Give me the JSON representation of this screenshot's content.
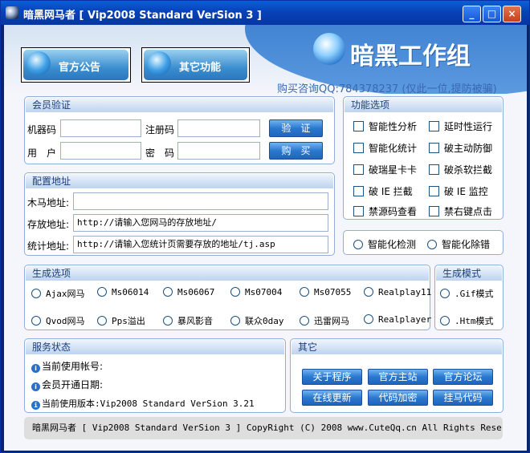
{
  "window": {
    "title": "暗黑网马者 [ Vip2008 Standard VerSion 3 ]",
    "min": "_",
    "max": "□",
    "close": "×"
  },
  "banner": {
    "btn_notice": "官方公告",
    "btn_other": "其它功能",
    "logo": "暗黑工作组",
    "contact": "购买咨询QQ:784378237 (仅此一位,提防被骗)"
  },
  "member": {
    "header": "会员验证",
    "machine_label": "机器码",
    "regcode_label": "注册码",
    "user_label": "用　户",
    "pwd_label": "密　码",
    "verify_btn": "验　证",
    "buy_btn": "购　买"
  },
  "config": {
    "header": "配置地址",
    "trojan_label": "木马地址:",
    "trojan_value": "",
    "store_label": "存放地址:",
    "store_value": "http://请输入您网马的存放地址/",
    "stats_label": "统计地址:",
    "stats_value": "http://请输入您统计页需要存放的地址/tj.asp"
  },
  "features": {
    "header": "功能选项",
    "items": [
      "智能性分析",
      "延时性运行",
      "智能化统计",
      "破主动防御",
      "破瑞星卡卡",
      "破杀软拦截",
      "破 IE 拦截",
      "破 IE 监控",
      "禁源码查看",
      "禁右键点击"
    ],
    "radio_detect": "智能化检测",
    "radio_clear": "智能化除错"
  },
  "generate": {
    "header": "生成选项",
    "items": [
      "Ajax网马",
      "Ms06014",
      "Ms06067",
      "Ms07004",
      "Ms07055",
      "Realplay11",
      "Qvod网马",
      "Pps溢出",
      "暴风影音",
      "联众0day",
      "迅雷网马",
      "Realplayer"
    ]
  },
  "mode": {
    "header": "生成模式",
    "gif": ".Gif模式",
    "htm": ".Htm模式"
  },
  "service": {
    "header": "服务状态",
    "account": "当前使用帐号:",
    "open_date": "会员开通日期:",
    "version": "当前使用版本:Vip2008 Standard VerSion 3.21"
  },
  "other": {
    "header": "其它",
    "buttons": [
      "关于程序",
      "官方主站",
      "官方论坛",
      "在线更新",
      "代码加密",
      "挂马代码"
    ]
  },
  "footer": {
    "text": "暗黑网马者 [ Vip2008 Standard VerSion 3 ] CopyRight (C) 2008 www.CuteQq.cn All Rights Reserved ."
  }
}
